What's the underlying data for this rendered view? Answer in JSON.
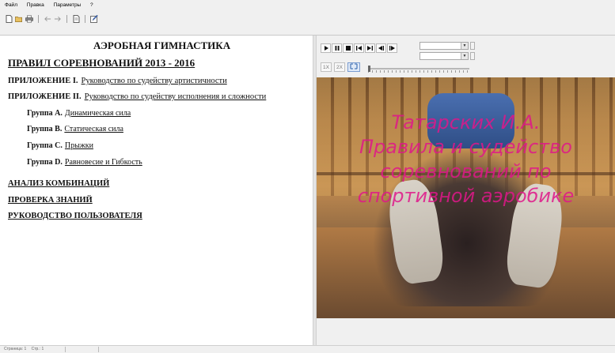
{
  "menu": {
    "items": [
      "Файл",
      "Правка",
      "Параметры",
      "?"
    ]
  },
  "toolbar": {
    "icons": [
      "new-document-icon",
      "open-folder-icon",
      "print-icon",
      "back-arrow-icon",
      "forward-arrow-icon",
      "page-icon",
      "edit-icon"
    ]
  },
  "content": {
    "title": "АЭРОБНАЯ ГИМНАСТИКА",
    "rules_heading": "ПРАВИЛ СОРЕВНОВАНИЙ 2013 - 2016",
    "appendix1": {
      "label": "ПРИЛОЖЕНИЕ I.",
      "link": "Руководство по судейству артистичности"
    },
    "appendix2": {
      "label": "ПРИЛОЖЕНИЕ II.",
      "link": "Руководство по судейству исполнения и сложности"
    },
    "groups": [
      {
        "label": "Группа А.",
        "link": "Динамическая сила"
      },
      {
        "label": "Группа В.",
        "link": "Статическая сила"
      },
      {
        "label": "Группа С.",
        "link": "Прыжки"
      },
      {
        "label": "Группа D.",
        "link": "Равновесие и Гибкость"
      }
    ],
    "sections": [
      "АНАЛИЗ КОМБИНАЦИЙ",
      "ПРОВЕРКА ЗНАНИЙ",
      "РУКОВОДСТВО ПОЛЬЗОВАТЕЛЯ"
    ]
  },
  "player": {
    "buttons": [
      "play-icon",
      "pause-icon",
      "stop-icon",
      "skip-start-icon",
      "skip-end-icon",
      "step-back-icon",
      "step-forward-icon"
    ],
    "speeds": [
      "1X",
      "2X"
    ],
    "video_text": [
      "Татарских И.А.",
      "Правила и судейство",
      "соревнований по",
      "спортивной аэробике"
    ]
  },
  "status": {
    "page": "Страница: 1",
    "pages": "Стр.: 1"
  }
}
